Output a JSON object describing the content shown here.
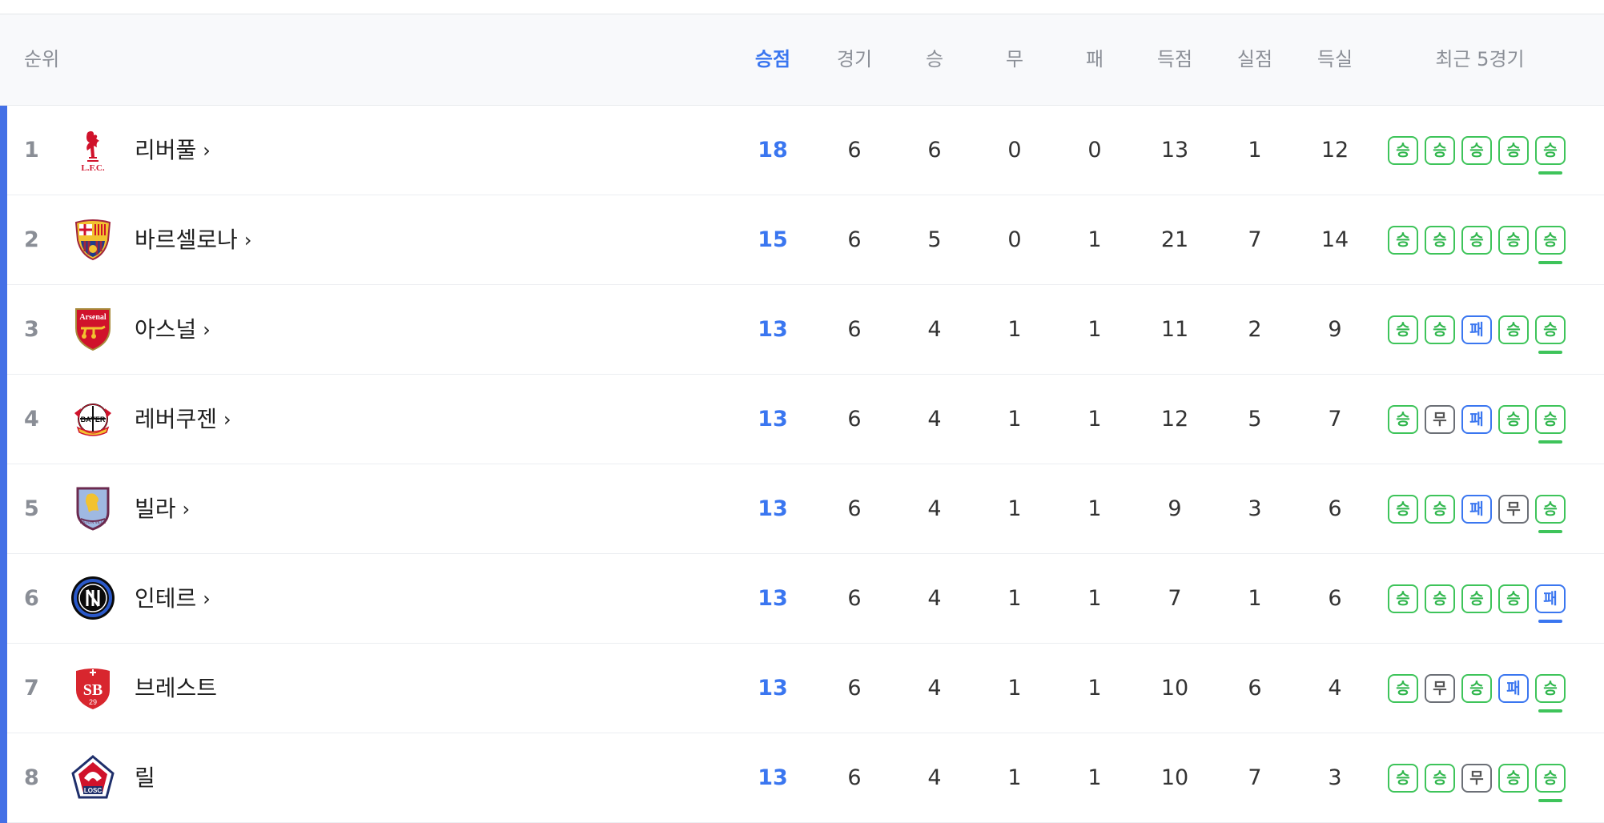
{
  "columns": {
    "rank": "순위",
    "points": "승점",
    "played": "경기",
    "won": "승",
    "drawn": "무",
    "lost": "패",
    "goals_for": "득점",
    "goals_against": "실점",
    "goal_diff": "득실",
    "recent": "최근 5경기"
  },
  "result_labels": {
    "W": "승",
    "D": "무",
    "L": "패"
  },
  "colors": {
    "accent": "#3a76f0",
    "win": "#3ec45a",
    "draw": "#6b6f76",
    "loss": "#3a76f0",
    "qualify_bar": "#4470e6"
  },
  "rows": [
    {
      "rank": "1",
      "team": "리버풀",
      "link": true,
      "crest": "liverpool",
      "points": "18",
      "played": "6",
      "won": "6",
      "drawn": "0",
      "lost": "0",
      "gf": "13",
      "ga": "1",
      "gd": "12",
      "form": [
        "W",
        "W",
        "W",
        "W",
        "W"
      ]
    },
    {
      "rank": "2",
      "team": "바르셀로나",
      "link": true,
      "crest": "barcelona",
      "points": "15",
      "played": "6",
      "won": "5",
      "drawn": "0",
      "lost": "1",
      "gf": "21",
      "ga": "7",
      "gd": "14",
      "form": [
        "W",
        "W",
        "W",
        "W",
        "W"
      ]
    },
    {
      "rank": "3",
      "team": "아스널",
      "link": true,
      "crest": "arsenal",
      "points": "13",
      "played": "6",
      "won": "4",
      "drawn": "1",
      "lost": "1",
      "gf": "11",
      "ga": "2",
      "gd": "9",
      "form": [
        "W",
        "W",
        "L",
        "W",
        "W"
      ]
    },
    {
      "rank": "4",
      "team": "레버쿠젠",
      "link": true,
      "crest": "leverkusen",
      "points": "13",
      "played": "6",
      "won": "4",
      "drawn": "1",
      "lost": "1",
      "gf": "12",
      "ga": "5",
      "gd": "7",
      "form": [
        "W",
        "D",
        "L",
        "W",
        "W"
      ]
    },
    {
      "rank": "5",
      "team": "빌라",
      "link": true,
      "crest": "villa",
      "points": "13",
      "played": "6",
      "won": "4",
      "drawn": "1",
      "lost": "1",
      "gf": "9",
      "ga": "3",
      "gd": "6",
      "form": [
        "W",
        "W",
        "L",
        "D",
        "W"
      ]
    },
    {
      "rank": "6",
      "team": "인테르",
      "link": true,
      "crest": "inter",
      "points": "13",
      "played": "6",
      "won": "4",
      "drawn": "1",
      "lost": "1",
      "gf": "7",
      "ga": "1",
      "gd": "6",
      "form": [
        "W",
        "W",
        "W",
        "W",
        "L"
      ]
    },
    {
      "rank": "7",
      "team": "브레스트",
      "link": false,
      "crest": "brest",
      "points": "13",
      "played": "6",
      "won": "4",
      "drawn": "1",
      "lost": "1",
      "gf": "10",
      "ga": "6",
      "gd": "4",
      "form": [
        "W",
        "D",
        "W",
        "L",
        "W"
      ]
    },
    {
      "rank": "8",
      "team": "릴",
      "link": false,
      "crest": "lille",
      "points": "13",
      "played": "6",
      "won": "4",
      "drawn": "1",
      "lost": "1",
      "gf": "10",
      "ga": "7",
      "gd": "3",
      "form": [
        "W",
        "W",
        "D",
        "W",
        "W"
      ]
    }
  ]
}
